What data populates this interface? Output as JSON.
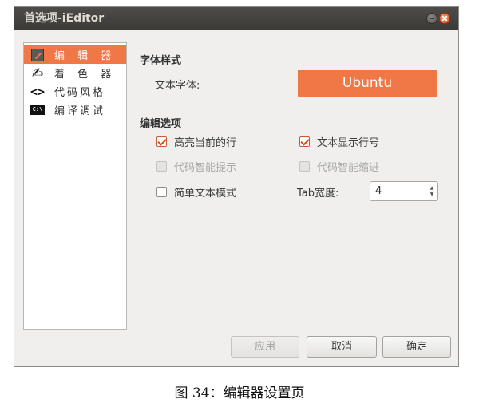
{
  "window": {
    "title": "首选项-iEditor"
  },
  "sidebar": {
    "items": [
      {
        "label": "编 辑 器",
        "icon": "editor-icon",
        "active": true
      },
      {
        "label": "着 色 器",
        "icon": "brush-icon",
        "active": false
      },
      {
        "label": "代码风格",
        "icon": "code-icon",
        "active": false
      },
      {
        "label": "编译调试",
        "icon": "terminal-icon",
        "active": false
      }
    ],
    "terminal_icon_text": "C:\\"
  },
  "font_section": {
    "title": "字体样式",
    "font_label": "文本字体:",
    "font_value": "Ubuntu"
  },
  "edit_section": {
    "title": "编辑选项",
    "options": {
      "highlight_line": {
        "label": "高亮当前的行",
        "checked": true,
        "enabled": true
      },
      "show_line_numbers": {
        "label": "文本显示行号",
        "checked": true,
        "enabled": true
      },
      "smart_hints": {
        "label": "代码智能提示",
        "checked": false,
        "enabled": false
      },
      "smart_indent": {
        "label": "代码智能缩进",
        "checked": false,
        "enabled": false
      },
      "simple_mode": {
        "label": "简单文本模式",
        "checked": false,
        "enabled": true
      }
    },
    "tab_width_label": "Tab宽度:",
    "tab_width_value": "4"
  },
  "buttons": {
    "apply": "应用",
    "cancel": "取消",
    "ok": "确定"
  },
  "caption": "图 34：编辑器设置页",
  "colors": {
    "accent": "#f07746",
    "titlebar": "#3c3b37",
    "close": "#dd4814"
  }
}
